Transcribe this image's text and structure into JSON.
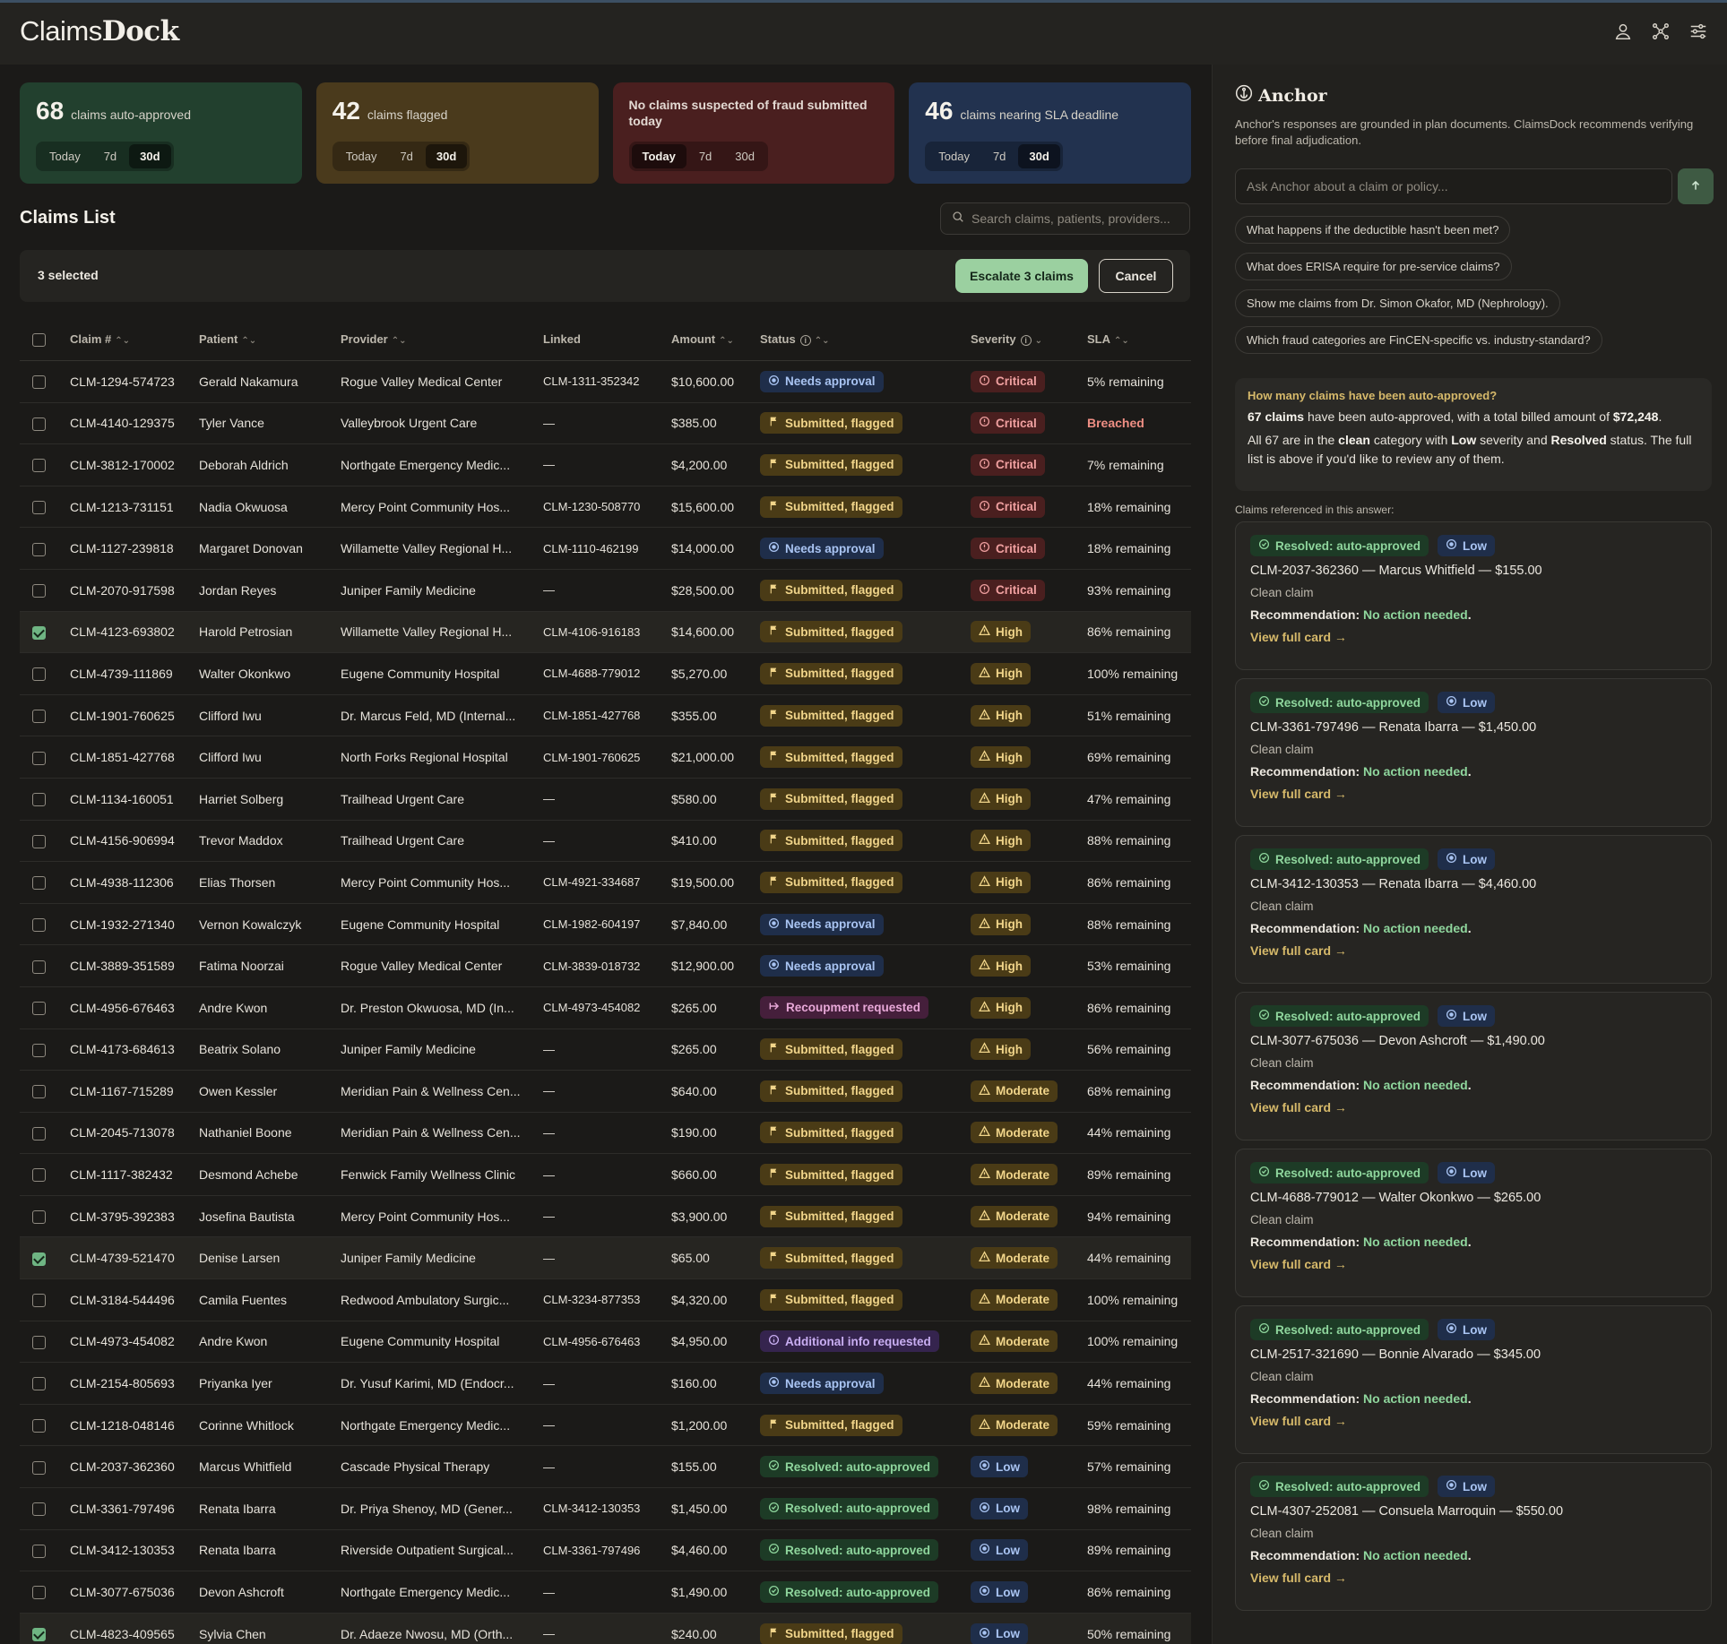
{
  "app": {
    "logo_light": "Claims",
    "logo_bold": "Dock"
  },
  "topbar_icons": [
    "user-icon",
    "scan-icon",
    "sliders-icon"
  ],
  "stat_cards": [
    {
      "num": "68",
      "label": "claims auto-approved",
      "color": "#22402e",
      "pills": [
        "Today",
        "7d",
        "30d"
      ],
      "active": "30d"
    },
    {
      "num": "42",
      "label": "claims flagged",
      "color": "#4a3a1c",
      "pills": [
        "Today",
        "7d",
        "30d"
      ],
      "active": "30d"
    },
    {
      "num": "",
      "label": "No claims suspected of fraud submitted today",
      "color": "#4a1f1f",
      "pills": [
        "Today",
        "7d",
        "30d"
      ],
      "active": "Today"
    },
    {
      "num": "46",
      "label": "claims nearing SLA deadline",
      "color": "#22324f",
      "pills": [
        "Today",
        "7d",
        "30d"
      ],
      "active": "30d"
    }
  ],
  "list": {
    "title": "Claims List",
    "search_placeholder": "Search claims, patients, providers...",
    "selected_text": "3 selected",
    "escalate_label": "Escalate 3 claims",
    "cancel_label": "Cancel"
  },
  "columns": [
    "Claim #",
    "Patient",
    "Provider",
    "Linked",
    "Amount",
    "Status",
    "Severity",
    "SLA"
  ],
  "rows": [
    {
      "claim": "CLM-1294-574723",
      "patient": "Gerald Nakamura",
      "provider": "Rogue Valley Medical Center",
      "linked": "CLM-1311-352342",
      "amount": "$10,600.00",
      "status": "Needs approval",
      "skind": "need",
      "severity": "Critical",
      "sev": "crit",
      "sla": "5% remaining",
      "checked": false
    },
    {
      "claim": "CLM-4140-129375",
      "patient": "Tyler Vance",
      "provider": "Valleybrook Urgent Care",
      "linked": "—",
      "amount": "$385.00",
      "status": "Submitted, flagged",
      "skind": "flag",
      "severity": "Critical",
      "sev": "crit",
      "sla": "Breached",
      "checked": false
    },
    {
      "claim": "CLM-3812-170002",
      "patient": "Deborah Aldrich",
      "provider": "Northgate Emergency Medic...",
      "linked": "—",
      "amount": "$4,200.00",
      "status": "Submitted, flagged",
      "skind": "flag",
      "severity": "Critical",
      "sev": "crit",
      "sla": "7% remaining",
      "checked": false
    },
    {
      "claim": "CLM-1213-731151",
      "patient": "Nadia Okwuosa",
      "provider": "Mercy Point Community Hos...",
      "linked": "CLM-1230-508770",
      "amount": "$15,600.00",
      "status": "Submitted, flagged",
      "skind": "flag",
      "severity": "Critical",
      "sev": "crit",
      "sla": "18% remaining",
      "checked": false
    },
    {
      "claim": "CLM-1127-239818",
      "patient": "Margaret Donovan",
      "provider": "Willamette Valley Regional H...",
      "linked": "CLM-1110-462199",
      "amount": "$14,000.00",
      "status": "Needs approval",
      "skind": "need",
      "severity": "Critical",
      "sev": "crit",
      "sla": "18% remaining",
      "checked": false
    },
    {
      "claim": "CLM-2070-917598",
      "patient": "Jordan Reyes",
      "provider": "Juniper Family Medicine",
      "linked": "—",
      "amount": "$28,500.00",
      "status": "Submitted, flagged",
      "skind": "flag",
      "severity": "Critical",
      "sev": "crit",
      "sla": "93% remaining",
      "checked": false
    },
    {
      "claim": "CLM-4123-693802",
      "patient": "Harold Petrosian",
      "provider": "Willamette Valley Regional H...",
      "linked": "CLM-4106-916183",
      "amount": "$14,600.00",
      "status": "Submitted, flagged",
      "skind": "flag",
      "severity": "High",
      "sev": "high",
      "sla": "86% remaining",
      "checked": true
    },
    {
      "claim": "CLM-4739-111869",
      "patient": "Walter Okonkwo",
      "provider": "Eugene Community Hospital",
      "linked": "CLM-4688-779012",
      "amount": "$5,270.00",
      "status": "Submitted, flagged",
      "skind": "flag",
      "severity": "High",
      "sev": "high",
      "sla": "100% remaining",
      "checked": false
    },
    {
      "claim": "CLM-1901-760625",
      "patient": "Clifford Iwu",
      "provider": "Dr. Marcus Feld, MD (Internal...",
      "linked": "CLM-1851-427768",
      "amount": "$355.00",
      "status": "Submitted, flagged",
      "skind": "flag",
      "severity": "High",
      "sev": "high",
      "sla": "51% remaining",
      "checked": false
    },
    {
      "claim": "CLM-1851-427768",
      "patient": "Clifford Iwu",
      "provider": "North Forks Regional Hospital",
      "linked": "CLM-1901-760625",
      "amount": "$21,000.00",
      "status": "Submitted, flagged",
      "skind": "flag",
      "severity": "High",
      "sev": "high",
      "sla": "69% remaining",
      "checked": false
    },
    {
      "claim": "CLM-1134-160051",
      "patient": "Harriet Solberg",
      "provider": "Trailhead Urgent Care",
      "linked": "—",
      "amount": "$580.00",
      "status": "Submitted, flagged",
      "skind": "flag",
      "severity": "High",
      "sev": "high",
      "sla": "47% remaining",
      "checked": false
    },
    {
      "claim": "CLM-4156-906994",
      "patient": "Trevor Maddox",
      "provider": "Trailhead Urgent Care",
      "linked": "—",
      "amount": "$410.00",
      "status": "Submitted, flagged",
      "skind": "flag",
      "severity": "High",
      "sev": "high",
      "sla": "88% remaining",
      "checked": false
    },
    {
      "claim": "CLM-4938-112306",
      "patient": "Elias Thorsen",
      "provider": "Mercy Point Community Hos...",
      "linked": "CLM-4921-334687",
      "amount": "$19,500.00",
      "status": "Submitted, flagged",
      "skind": "flag",
      "severity": "High",
      "sev": "high",
      "sla": "86% remaining",
      "checked": false
    },
    {
      "claim": "CLM-1932-271340",
      "patient": "Vernon Kowalczyk",
      "provider": "Eugene Community Hospital",
      "linked": "CLM-1982-604197",
      "amount": "$7,840.00",
      "status": "Needs approval",
      "skind": "need",
      "severity": "High",
      "sev": "high",
      "sla": "88% remaining",
      "checked": false
    },
    {
      "claim": "CLM-3889-351589",
      "patient": "Fatima Noorzai",
      "provider": "Rogue Valley Medical Center",
      "linked": "CLM-3839-018732",
      "amount": "$12,900.00",
      "status": "Needs approval",
      "skind": "need",
      "severity": "High",
      "sev": "high",
      "sla": "53% remaining",
      "checked": false
    },
    {
      "claim": "CLM-4956-676463",
      "patient": "Andre Kwon",
      "provider": "Dr. Preston Okwuosa, MD (In...",
      "linked": "CLM-4973-454082",
      "amount": "$265.00",
      "status": "Recoupment requested",
      "skind": "recoup",
      "severity": "High",
      "sev": "high",
      "sla": "86% remaining",
      "checked": false
    },
    {
      "claim": "CLM-4173-684613",
      "patient": "Beatrix Solano",
      "provider": "Juniper Family Medicine",
      "linked": "—",
      "amount": "$265.00",
      "status": "Submitted, flagged",
      "skind": "flag",
      "severity": "High",
      "sev": "high",
      "sla": "56% remaining",
      "checked": false
    },
    {
      "claim": "CLM-1167-715289",
      "patient": "Owen Kessler",
      "provider": "Meridian Pain & Wellness Cen...",
      "linked": "—",
      "amount": "$640.00",
      "status": "Submitted, flagged",
      "skind": "flag",
      "severity": "Moderate",
      "sev": "mod",
      "sla": "68% remaining",
      "checked": false
    },
    {
      "claim": "CLM-2045-713078",
      "patient": "Nathaniel Boone",
      "provider": "Meridian Pain & Wellness Cen...",
      "linked": "—",
      "amount": "$190.00",
      "status": "Submitted, flagged",
      "skind": "flag",
      "severity": "Moderate",
      "sev": "mod",
      "sla": "44% remaining",
      "checked": false
    },
    {
      "claim": "CLM-1117-382432",
      "patient": "Desmond Achebe",
      "provider": "Fenwick Family Wellness Clinic",
      "linked": "—",
      "amount": "$660.00",
      "status": "Submitted, flagged",
      "skind": "flag",
      "severity": "Moderate",
      "sev": "mod",
      "sla": "89% remaining",
      "checked": false
    },
    {
      "claim": "CLM-3795-392383",
      "patient": "Josefina Bautista",
      "provider": "Mercy Point Community Hos...",
      "linked": "—",
      "amount": "$3,900.00",
      "status": "Submitted, flagged",
      "skind": "flag",
      "severity": "Moderate",
      "sev": "mod",
      "sla": "94% remaining",
      "checked": false
    },
    {
      "claim": "CLM-4739-521470",
      "patient": "Denise Larsen",
      "provider": "Juniper Family Medicine",
      "linked": "—",
      "amount": "$65.00",
      "status": "Submitted, flagged",
      "skind": "flag",
      "severity": "Moderate",
      "sev": "mod",
      "sla": "44% remaining",
      "checked": true
    },
    {
      "claim": "CLM-3184-544496",
      "patient": "Camila Fuentes",
      "provider": "Redwood Ambulatory Surgic...",
      "linked": "CLM-3234-877353",
      "amount": "$4,320.00",
      "status": "Submitted, flagged",
      "skind": "flag",
      "severity": "Moderate",
      "sev": "mod",
      "sla": "100% remaining",
      "checked": false
    },
    {
      "claim": "CLM-4973-454082",
      "patient": "Andre Kwon",
      "provider": "Eugene Community Hospital",
      "linked": "CLM-4956-676463",
      "amount": "$4,950.00",
      "status": "Additional info requested",
      "skind": "addl",
      "severity": "Moderate",
      "sev": "mod",
      "sla": "100% remaining",
      "checked": false
    },
    {
      "claim": "CLM-2154-805693",
      "patient": "Priyanka Iyer",
      "provider": "Dr. Yusuf Karimi, MD (Endocr...",
      "linked": "—",
      "amount": "$160.00",
      "status": "Needs approval",
      "skind": "need",
      "severity": "Moderate",
      "sev": "mod",
      "sla": "44% remaining",
      "checked": false
    },
    {
      "claim": "CLM-1218-048146",
      "patient": "Corinne Whitlock",
      "provider": "Northgate Emergency Medic...",
      "linked": "—",
      "amount": "$1,200.00",
      "status": "Submitted, flagged",
      "skind": "flag",
      "severity": "Moderate",
      "sev": "mod",
      "sla": "59% remaining",
      "checked": false
    },
    {
      "claim": "CLM-2037-362360",
      "patient": "Marcus Whitfield",
      "provider": "Cascade Physical Therapy",
      "linked": "—",
      "amount": "$155.00",
      "status": "Resolved: auto-approved",
      "skind": "res",
      "severity": "Low",
      "sev": "low",
      "sla": "57% remaining",
      "checked": false
    },
    {
      "claim": "CLM-3361-797496",
      "patient": "Renata Ibarra",
      "provider": "Dr. Priya Shenoy, MD (Gener...",
      "linked": "CLM-3412-130353",
      "amount": "$1,450.00",
      "status": "Resolved: auto-approved",
      "skind": "res",
      "severity": "Low",
      "sev": "low",
      "sla": "98% remaining",
      "checked": false
    },
    {
      "claim": "CLM-3412-130353",
      "patient": "Renata Ibarra",
      "provider": "Riverside Outpatient Surgical...",
      "linked": "CLM-3361-797496",
      "amount": "$4,460.00",
      "status": "Resolved: auto-approved",
      "skind": "res",
      "severity": "Low",
      "sev": "low",
      "sla": "89% remaining",
      "checked": false
    },
    {
      "claim": "CLM-3077-675036",
      "patient": "Devon Ashcroft",
      "provider": "Northgate Emergency Medic...",
      "linked": "—",
      "amount": "$1,490.00",
      "status": "Resolved: auto-approved",
      "skind": "res",
      "severity": "Low",
      "sev": "low",
      "sla": "86% remaining",
      "checked": false
    },
    {
      "claim": "CLM-4823-409565",
      "patient": "Sylvia Chen",
      "provider": "Dr. Adaeze Nwosu, MD (Orth...",
      "linked": "—",
      "amount": "$240.00",
      "status": "Submitted, flagged",
      "skind": "flag",
      "severity": "Low",
      "sev": "low",
      "sla": "50% remaining",
      "checked": true
    }
  ],
  "anchor": {
    "title": "Anchor",
    "subtitle": "Anchor's responses are grounded in plan documents. ClaimsDock recommends verifying before final adjudication.",
    "ask_placeholder": "Ask Anchor about a claim or policy...",
    "suggestions": [
      "What happens if the deductible hasn't been met?",
      "What does ERISA require for pre-service claims?",
      "Show me claims from Dr. Simon Okafor, MD (Nephrology).",
      "Which fraud categories are FinCEN-specific vs. industry-standard?"
    ],
    "question": "How many claims have been auto-approved?",
    "answer_1_bold": "67 claims",
    "answer_1_mid": " have been auto-approved, with a total billed amount of ",
    "answer_1_amount": "$72,248",
    "answer_1_end": ".",
    "answer_2_a": "All 67 are in the ",
    "answer_2_clean": "clean",
    "answer_2_b": " category with ",
    "answer_2_low": "Low",
    "answer_2_c": " severity and ",
    "answer_2_resolved": "Resolved",
    "answer_2_d": " status. The full list is above if you'd like to review any of them.",
    "refs_label": "Claims referenced in this answer:",
    "status_label": "Resolved: auto-approved",
    "severity_label": "Low",
    "clean_label": "Clean claim",
    "rec_label": "Recommendation: ",
    "rec_value": "No action needed",
    "rec_end": ".",
    "view_label": "View full card →",
    "refs": [
      "CLM-2037-362360 — Marcus Whitfield — $155.00",
      "CLM-3361-797496 — Renata Ibarra — $1,450.00",
      "CLM-3412-130353 — Renata Ibarra — $4,460.00",
      "CLM-3077-675036 — Devon Ashcroft — $1,490.00",
      "CLM-4688-779012 — Walter Okonkwo — $265.00",
      "CLM-2517-321690 — Bonnie Alvarado — $345.00",
      "CLM-4307-252081 — Consuela Marroquin — $550.00"
    ]
  }
}
